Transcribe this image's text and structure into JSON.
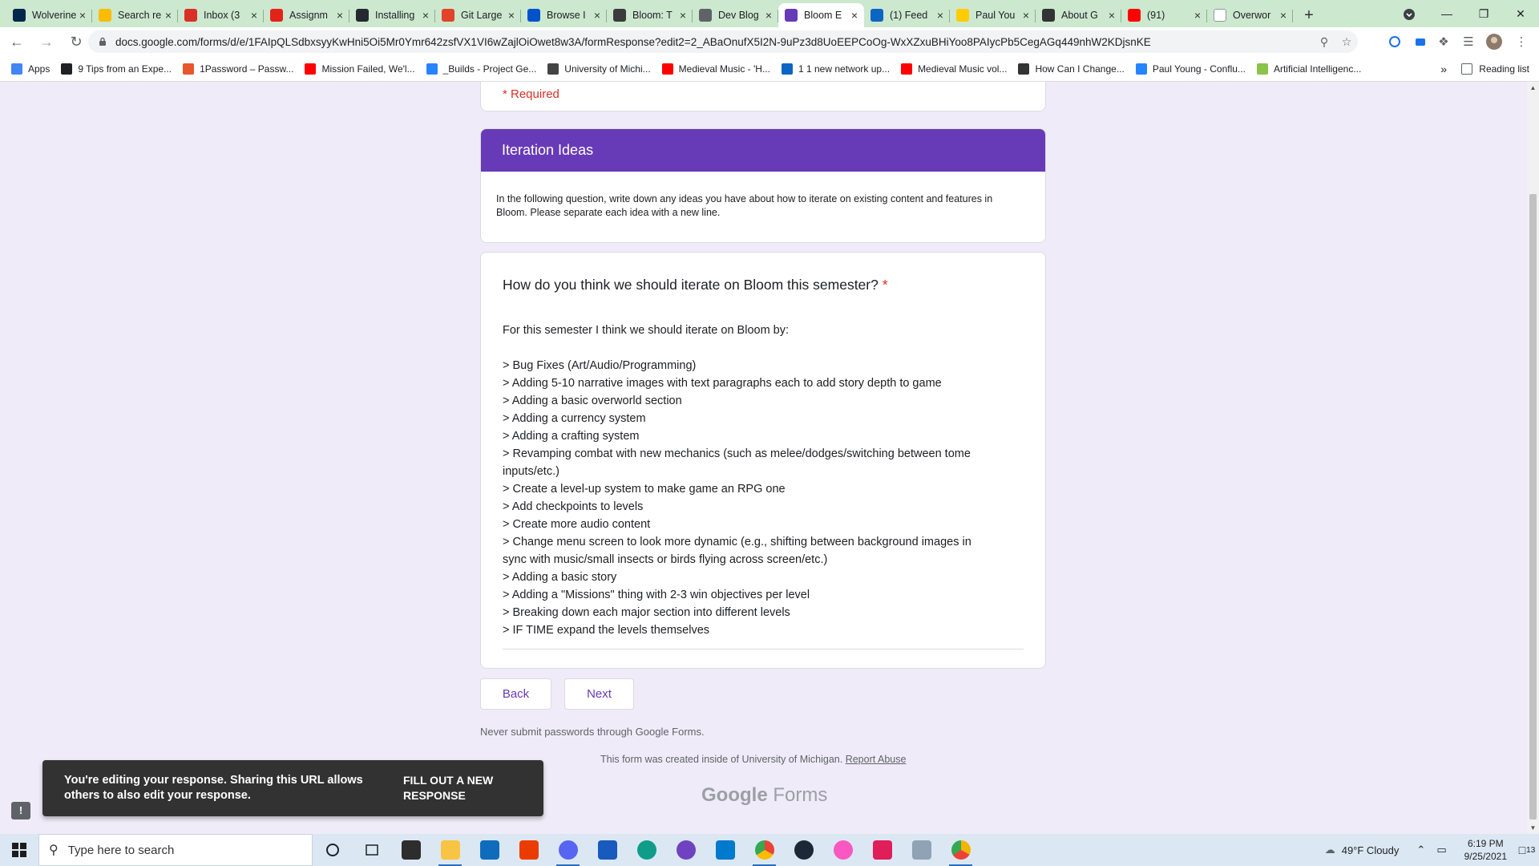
{
  "browser": {
    "tabs": [
      {
        "title": "Wolverine",
        "color": "#00274c"
      },
      {
        "title": "Search re",
        "color": "#fbbc04"
      },
      {
        "title": "Inbox (3",
        "color": "#d93025"
      },
      {
        "title": "Assignm",
        "color": "#e2231a"
      },
      {
        "title": "Installing",
        "color": "#24292f"
      },
      {
        "title": "Git Large",
        "color": "#e24329"
      },
      {
        "title": "Browse I",
        "color": "#0052cc"
      },
      {
        "title": "Bloom: T",
        "color": "#3b3b3b"
      },
      {
        "title": "Dev Blog",
        "color": "#5f6368"
      },
      {
        "title": "Bloom E",
        "color": "#673ab7",
        "active": true
      },
      {
        "title": "(1) Feed",
        "color": "#0a66c2"
      },
      {
        "title": "Paul You",
        "color": "#ffcb05"
      },
      {
        "title": "About G",
        "color": "#333333"
      },
      {
        "title": "(91)",
        "color": "#ff0000"
      },
      {
        "title": "Overwor",
        "color": "#ffffff"
      }
    ],
    "url": "docs.google.com/forms/d/e/1FAIpQLSdbxsyyKwHni5Oi5Mr0Ymr642zsfVX1VI6wZajlOiOwet8w3A/formResponse?edit2=2_ABaOnufX5I2N-9uPz3d8UoEEPCoOg-WxXZxuBHiYoo8PAIycPb5CegAGq449nhW2KDjsnKE",
    "bookmarks": [
      {
        "label": "Apps",
        "color": "#4285f4"
      },
      {
        "label": "9 Tips from an Expe...",
        "color": "#202124"
      },
      {
        "label": "1Password – Passw...",
        "color": "#e8572c"
      },
      {
        "label": "Mission Failed, We'l...",
        "color": "#ff0000"
      },
      {
        "label": "_Builds - Project Ge...",
        "color": "#2684ff"
      },
      {
        "label": "University of Michi...",
        "color": "#444444"
      },
      {
        "label": "Medieval Music - 'H...",
        "color": "#ff0000"
      },
      {
        "label": "1 1 new network up...",
        "color": "#0a66c2"
      },
      {
        "label": "Medieval Music vol...",
        "color": "#ff0000"
      },
      {
        "label": "How Can I Change...",
        "color": "#333333"
      },
      {
        "label": "Paul Young - Conflu...",
        "color": "#2684ff"
      },
      {
        "label": "Artificial Intelligenc...",
        "color": "#8bc34a"
      }
    ],
    "more": "»",
    "reading_list": "Reading list"
  },
  "form": {
    "required_note": "* Required",
    "section_title": "Iteration Ideas",
    "section_description": "In the following question, write down any ideas you have about how to iterate on existing content and features in Bloom. Please separate each idea with a new line.",
    "question_title": "How do you think we should iterate on Bloom this semester?",
    "required_star": "*",
    "answer_lines": [
      "For this semester I think we should iterate on Bloom by:",
      "",
      "> Bug Fixes (Art/Audio/Programming)",
      "> Adding 5-10 narrative images with text paragraphs each to add story depth to game",
      "> Adding a basic overworld section",
      "> Adding a currency system",
      "> Adding a crafting system",
      "> Revamping combat with new mechanics (such as melee/dodges/switching between tome",
      "inputs/etc.)",
      "> Create a level-up system to make game an RPG one",
      "> Add checkpoints to levels",
      "> Create more audio content",
      "> Change menu screen to look more dynamic (e.g., shifting between background images in",
      "sync with music/small insects or birds flying across screen/etc.)",
      "> Adding a basic story",
      "> Adding a \"Missions\" thing with 2-3 win objectives per level",
      "> Breaking down each major section into different levels",
      "> IF TIME expand the levels themselves"
    ],
    "back_label": "Back",
    "next_label": "Next",
    "password_note": "Never submit passwords through Google Forms.",
    "created_text": "This form was created inside of University of Michigan.",
    "report_abuse": "Report Abuse",
    "brand_google": "Google",
    "brand_forms": "Forms",
    "accent_color": "#673ab7"
  },
  "snackbar": {
    "message": "You're editing your response. Sharing this URL allows others to also edit your response.",
    "action": "FILL OUT A NEW RESPONSE"
  },
  "taskbar": {
    "search_placeholder": "Type here to search",
    "weather": "49°F  Cloudy",
    "time": "6:19 PM",
    "date": "9/25/2021",
    "notifications": "13"
  }
}
